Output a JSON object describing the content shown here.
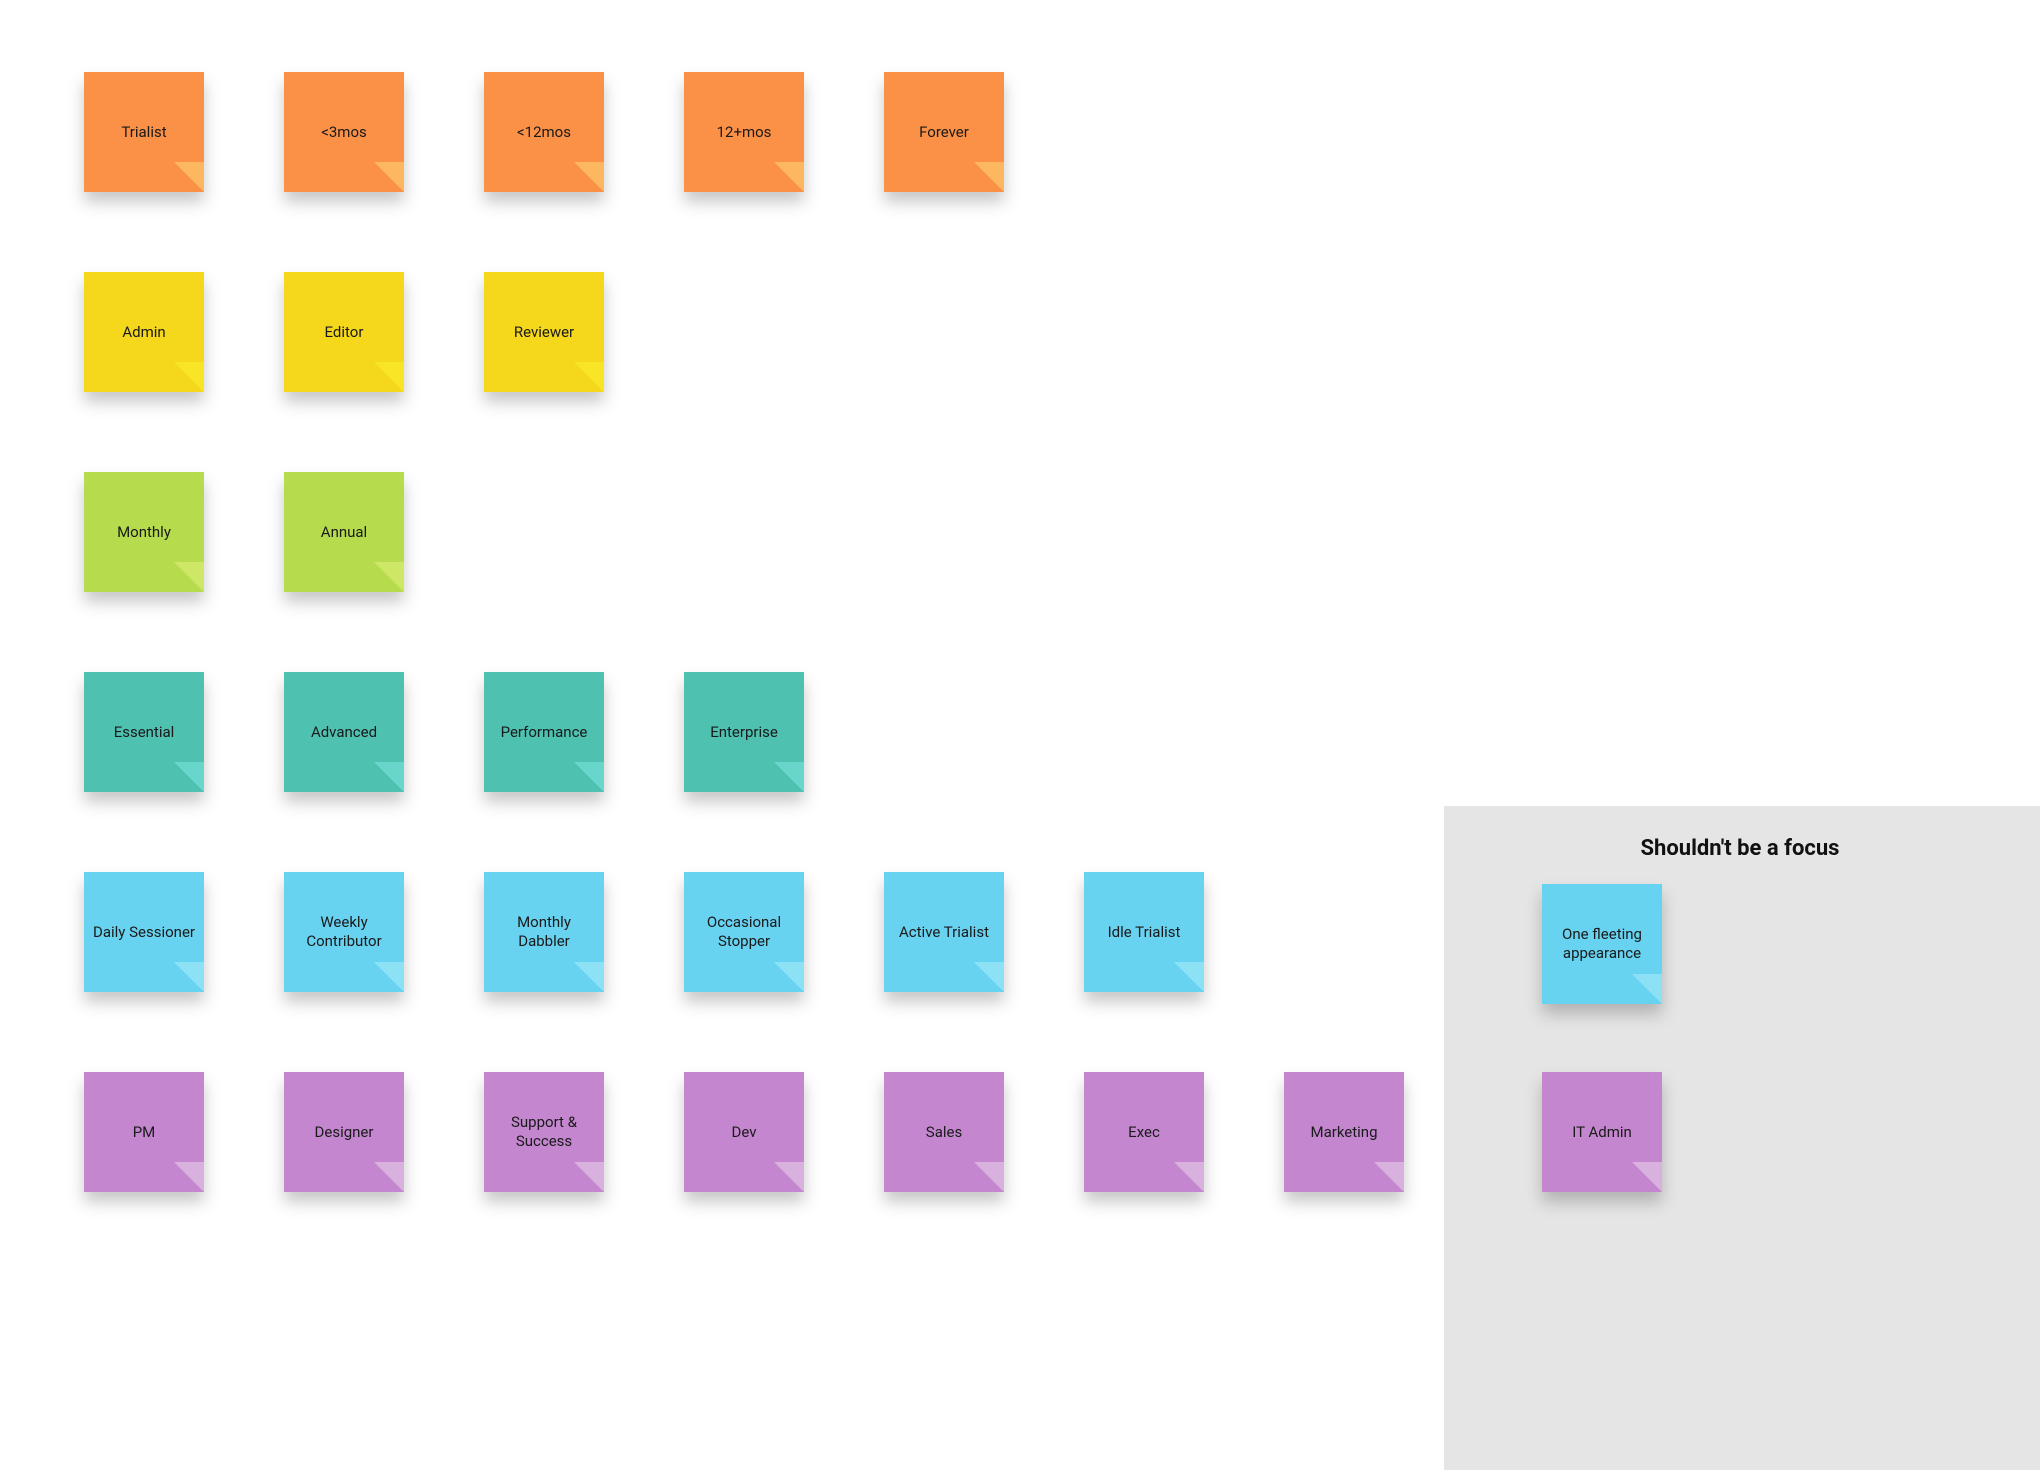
{
  "colors": {
    "orange": "#FB9047",
    "yellow": "#F5D71B",
    "lime": "#B6DB4C",
    "teal": "#4EC1B1",
    "sky": "#68D2F1",
    "violet": "#C487CF",
    "panel": "#E5E5E5"
  },
  "sidebar": {
    "title": "Shouldn't be a focus"
  },
  "notes": {
    "row1": [
      "Trialist",
      "<3mos",
      "<12mos",
      "12+mos",
      "Forever"
    ],
    "row2": [
      "Admin",
      "Editor",
      "Reviewer"
    ],
    "row3": [
      "Monthly",
      "Annual"
    ],
    "row4": [
      "Essential",
      "Advanced",
      "Performance",
      "Enterprise"
    ],
    "row5": [
      "Daily Sessioner",
      "Weekly Contributor",
      "Monthly Dabbler",
      "Occasional Stopper",
      "Active Trialist",
      "Idle Trialist"
    ],
    "row6": [
      "PM",
      "Designer",
      "Support & Success",
      "Dev",
      "Sales",
      "Exec",
      "Marketing"
    ],
    "sidebar_notes": {
      "sky": "One fleeting appearance",
      "violet": "IT Admin"
    }
  }
}
